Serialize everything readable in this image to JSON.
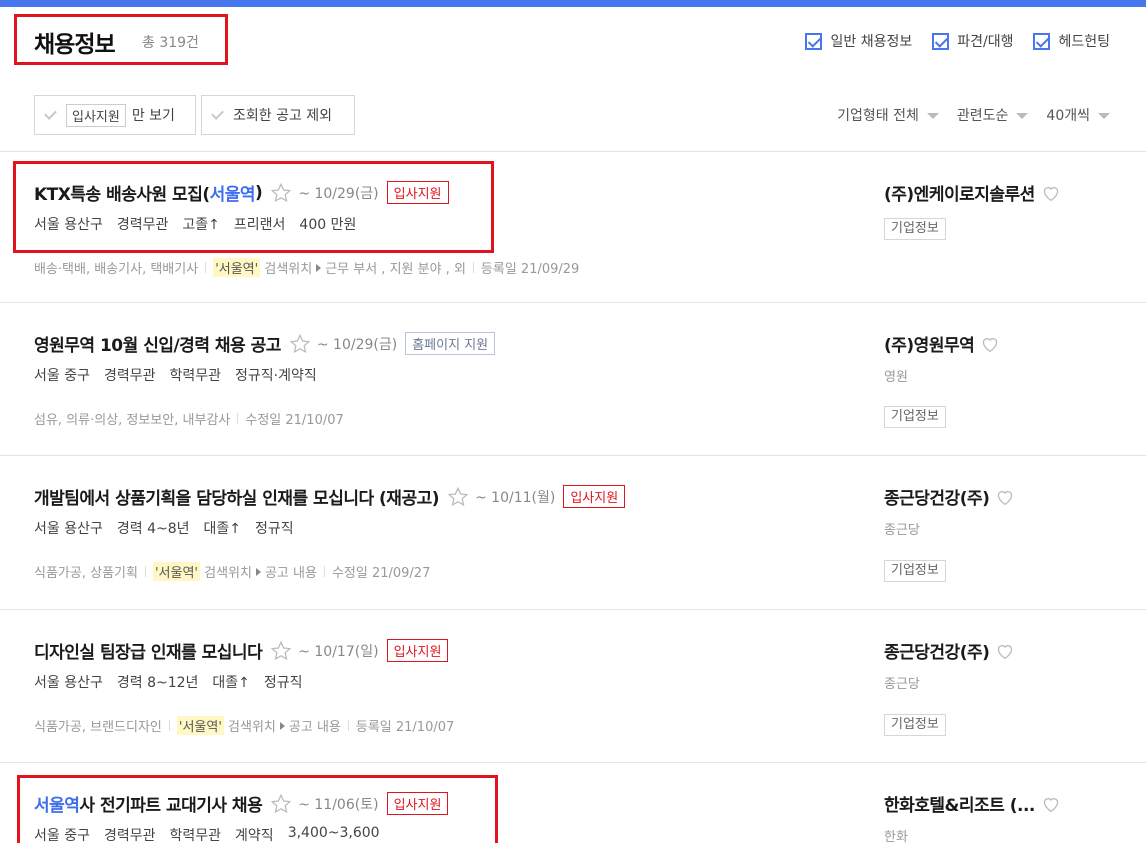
{
  "header": {
    "title": "채용정보",
    "total": "총 319건",
    "filters": [
      {
        "label": "일반 채용정보",
        "checked": true
      },
      {
        "label": "파견/대행",
        "checked": true
      },
      {
        "label": "헤드헌팅",
        "checked": true
      }
    ]
  },
  "toolbar": {
    "btn1_tag": "입사지원",
    "btn1_text": "만 보기",
    "btn2_text": "조회한 공고 제외",
    "sort_company": "기업형태 전체",
    "sort_order": "관련도순",
    "sort_count": "40개씩"
  },
  "jobs": [
    {
      "title": "KTX특송 배송사원 모집(",
      "title_highlight": "서울역",
      "title_end": ")",
      "deadline": "~ 10/29(금)",
      "apply": "입사지원",
      "location": "서울 용산구",
      "experience": "경력무관",
      "education": "고졸↑",
      "type": "프리랜서",
      "salary": "400 만원",
      "meta_cat": "배송·택배, 배송기사, 택배기사",
      "meta_kw": "'서울역'",
      "meta_search": "검색위치",
      "meta_pos": "근무 부서 , 지원 분야 , 외",
      "meta_date": "등록일 21/09/29",
      "company": "(주)엔케이로지솔루션",
      "company_type": "",
      "company_info": "기업정보"
    },
    {
      "title": "영원무역 10월 신입/경력 채용 공고",
      "deadline": "~ 10/29(금)",
      "apply": "홈페이지 지원",
      "location": "서울 중구",
      "experience": "경력무관",
      "education": "학력무관",
      "type": "정규직·계약직",
      "meta_cat": "섬유, 의류·의상, 정보보안, 내부감사",
      "meta_date": "수정일 21/10/07",
      "company": "(주)영원무역",
      "company_type": "영원",
      "company_info": "기업정보"
    },
    {
      "title": "개발팀에서 상품기획을 담당하실 인재를 모십니다 (재공고)",
      "deadline": "~ 10/11(월)",
      "apply": "입사지원",
      "location": "서울 용산구",
      "experience": "경력 4~8년",
      "education": "대졸↑",
      "type": "정규직",
      "meta_cat": "식품가공, 상품기획",
      "meta_kw": "'서울역'",
      "meta_search": "검색위치",
      "meta_pos": "공고 내용",
      "meta_date": "수정일 21/09/27",
      "company": "종근당건강(주)",
      "company_type": "종근당",
      "company_info": "기업정보"
    },
    {
      "title": "디자인실 팀장급 인재를 모십니다",
      "deadline": "~ 10/17(일)",
      "apply": "입사지원",
      "location": "서울 용산구",
      "experience": "경력 8~12년",
      "education": "대졸↑",
      "type": "정규직",
      "meta_cat": "식품가공, 브랜드디자인",
      "meta_kw": "'서울역'",
      "meta_search": "검색위치",
      "meta_pos": "공고 내용",
      "meta_date": "등록일 21/10/07",
      "company": "종근당건강(주)",
      "company_type": "종근당",
      "company_info": "기업정보"
    },
    {
      "title_highlight": "서울역",
      "title": "사 전기파트 교대기사 채용",
      "deadline": "~ 11/06(토)",
      "apply": "입사지원",
      "location": "서울 중구",
      "experience": "경력무관",
      "education": "학력무관",
      "type": "계약직",
      "salary": "3,400~3,600",
      "company": "한화호텔&리조트 (...",
      "company_type": "한화"
    }
  ],
  "colors": {
    "accent": "#4876ef",
    "highlight": "#3d6ef0",
    "apply_red": "#e0141e",
    "annotation": "#e0141e"
  }
}
